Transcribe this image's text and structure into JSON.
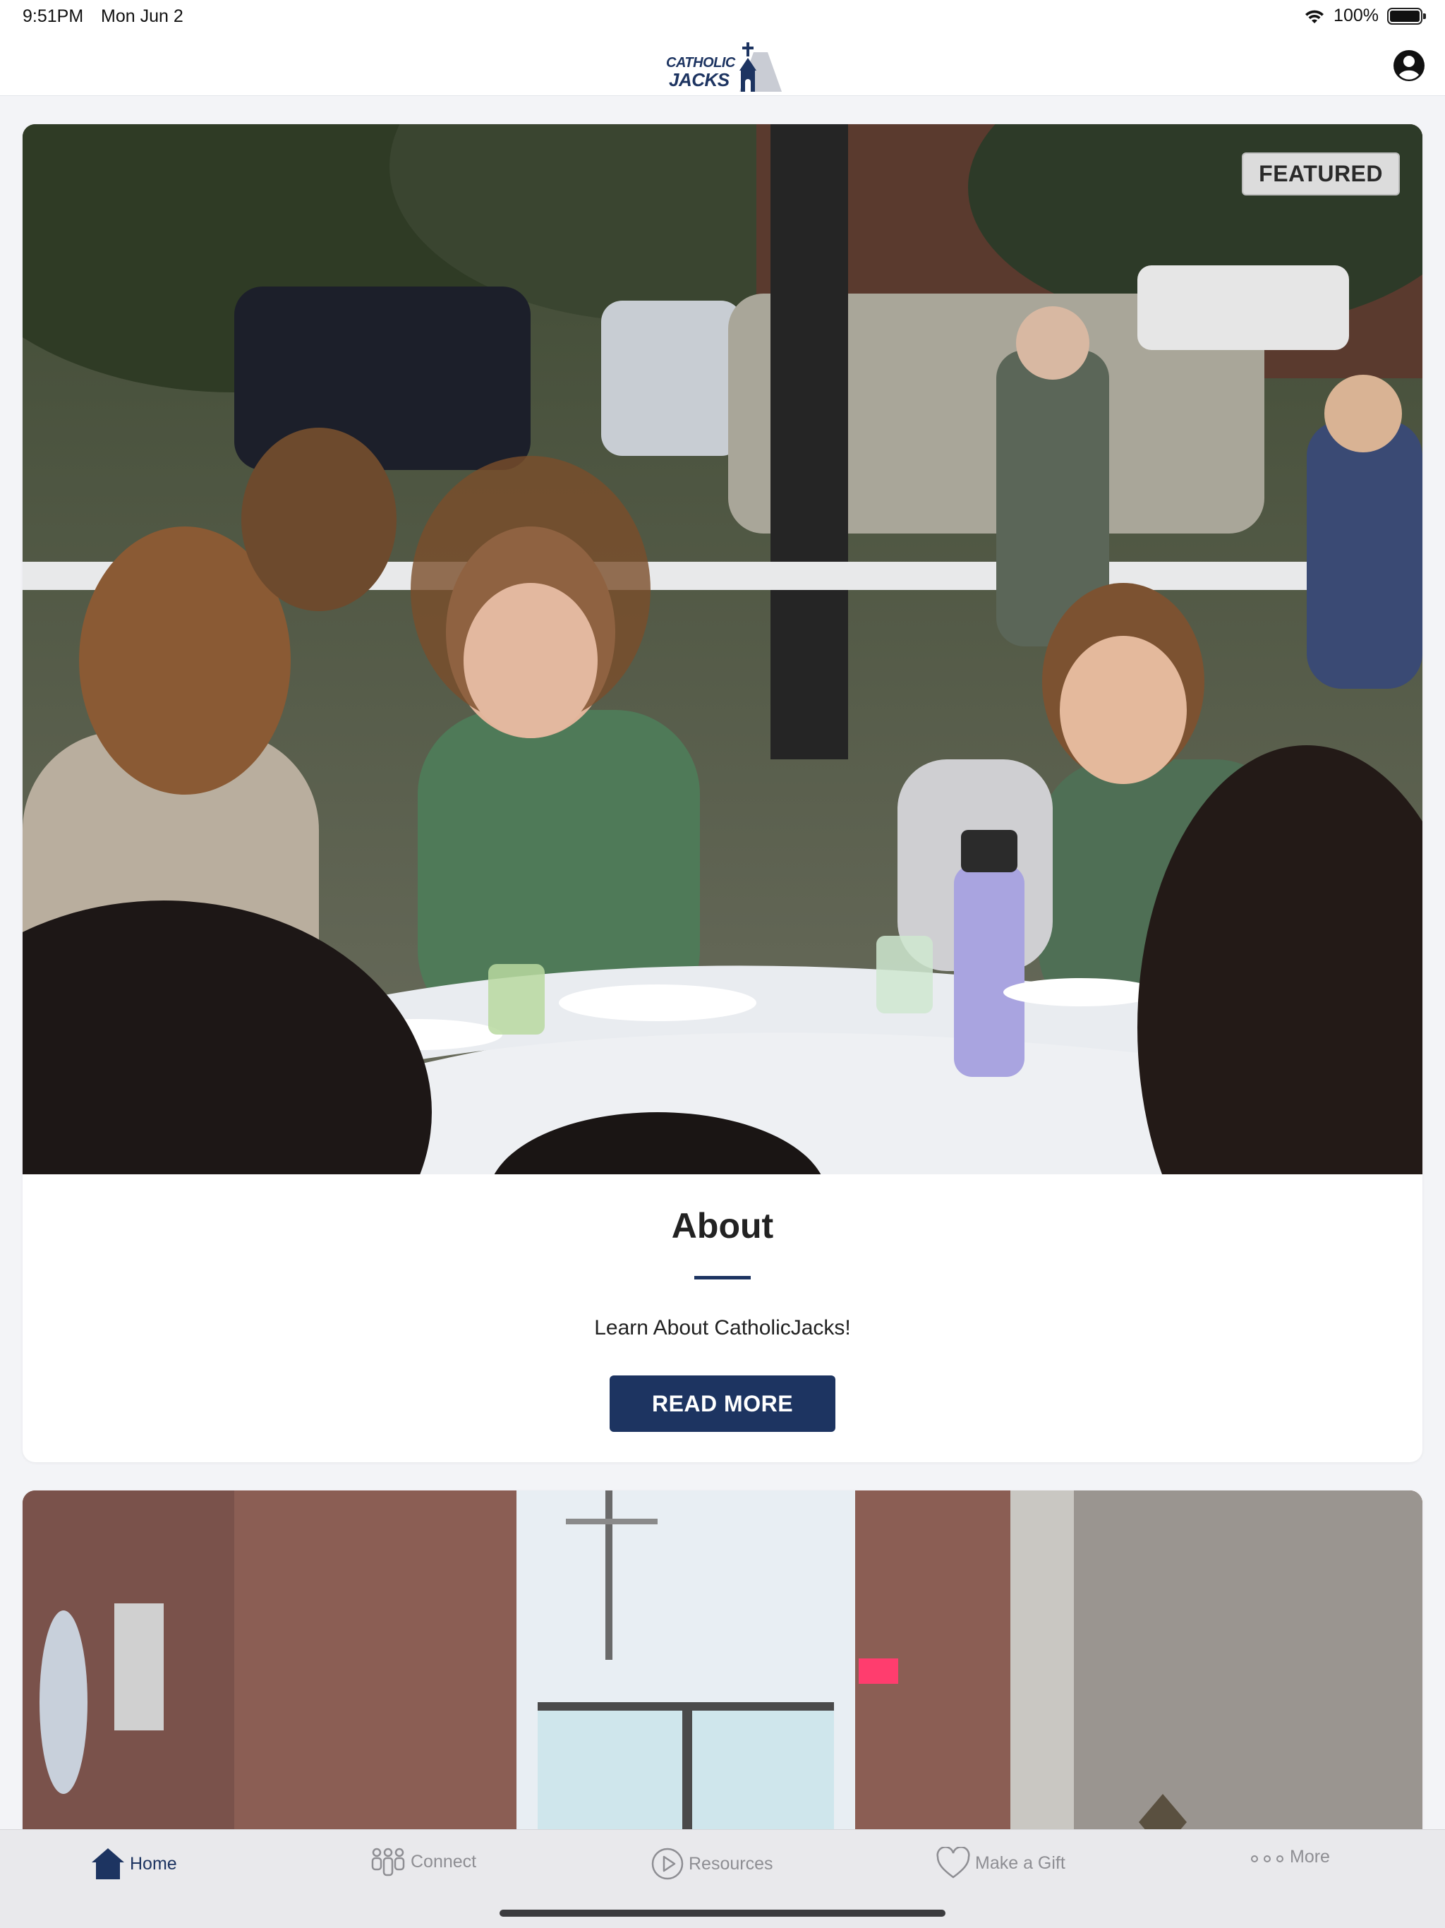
{
  "status_bar": {
    "time": "9:51PM",
    "date": "Mon Jun 2",
    "battery_text": "100%",
    "battery_level": 1.0,
    "icons": [
      "wifi-icon",
      "battery-icon"
    ]
  },
  "header": {
    "logo_line1": "CATHOLIC",
    "logo_line2": "JACKS",
    "profile_icon": "person-circle-icon"
  },
  "cards": [
    {
      "badge": "FEATURED",
      "title": "About",
      "subtitle": "Learn About CatholicJacks!",
      "button_label": "READ MORE"
    },
    {
      "badge": "",
      "title": "",
      "subtitle": "",
      "button_label": ""
    }
  ],
  "tab_bar": {
    "items": [
      {
        "label": "Home",
        "icon": "house-icon",
        "active": true
      },
      {
        "label": "Connect",
        "icon": "people-icon",
        "active": false
      },
      {
        "label": "Resources",
        "icon": "play-circle-icon",
        "active": false
      },
      {
        "label": "Make a Gift",
        "icon": "heart-icon",
        "active": false
      },
      {
        "label": "More",
        "icon": "ellipsis-icon",
        "active": false
      }
    ]
  },
  "colors": {
    "brand_navy": "#1d3461",
    "background": "#f3f4f7",
    "tab_inactive": "#8e8e93"
  }
}
